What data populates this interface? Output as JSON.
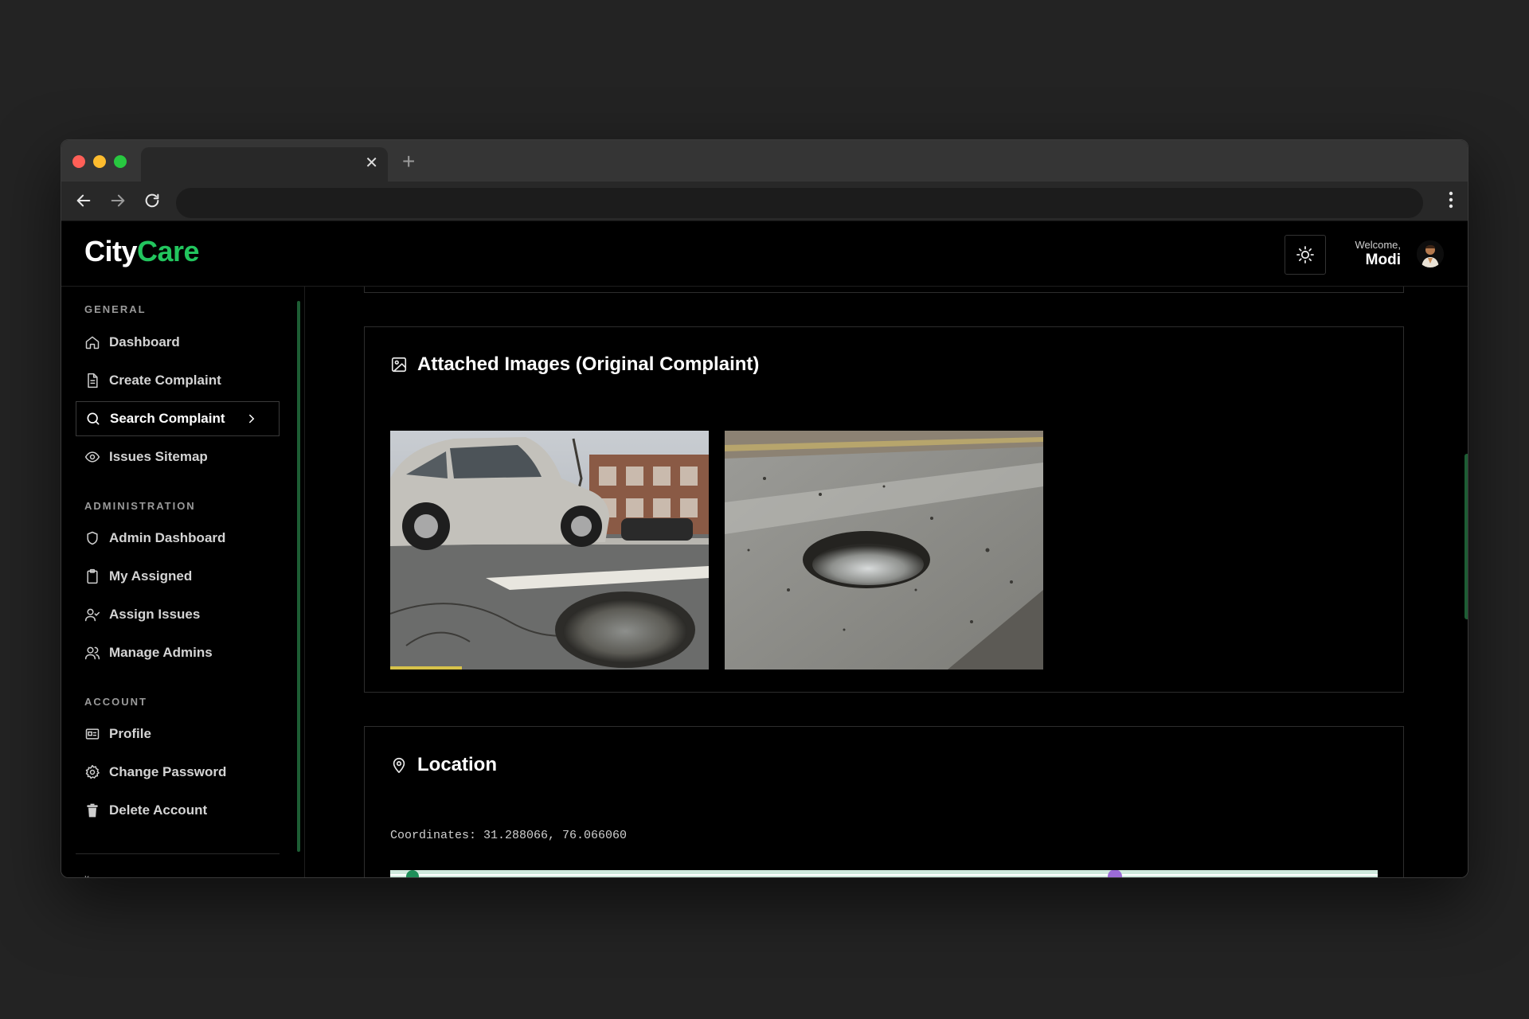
{
  "app": {
    "logo_part1": "City",
    "logo_part2": "Care",
    "welcome_label": "Welcome,",
    "user_name": "Modi"
  },
  "sidebar": {
    "sections": [
      {
        "label": "GENERAL",
        "items": [
          {
            "label": "Dashboard",
            "icon": "home-icon"
          },
          {
            "label": "Create Complaint",
            "icon": "file-icon"
          },
          {
            "label": "Search Complaint",
            "icon": "search-icon",
            "active": true
          },
          {
            "label": "Issues Sitemap",
            "icon": "eye-icon"
          }
        ]
      },
      {
        "label": "ADMINISTRATION",
        "items": [
          {
            "label": "Admin Dashboard",
            "icon": "shield-icon"
          },
          {
            "label": "My Assigned",
            "icon": "clipboard-icon"
          },
          {
            "label": "Assign Issues",
            "icon": "user-check-icon"
          },
          {
            "label": "Manage Admins",
            "icon": "users-icon"
          }
        ]
      },
      {
        "label": "ACCOUNT",
        "items": [
          {
            "label": "Profile",
            "icon": "id-card-icon"
          },
          {
            "label": "Change Password",
            "icon": "gear-icon"
          },
          {
            "label": "Delete Account",
            "icon": "trash-icon"
          }
        ]
      }
    ]
  },
  "main": {
    "images_card": {
      "title": "Attached Images (Original Complaint)",
      "images": [
        "Pothole near parked car",
        "Pothole in road"
      ]
    },
    "location_card": {
      "title": "Location",
      "coordinates": "Coordinates: 31.288066, 76.066060"
    }
  },
  "colors": {
    "accent": "#22c55e",
    "background": "#000000",
    "border": "#2d2d2d"
  }
}
